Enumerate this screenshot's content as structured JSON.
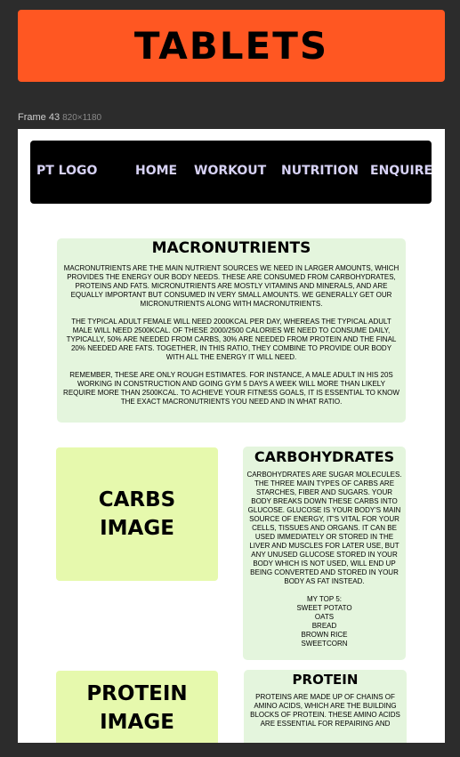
{
  "banner": {
    "title": "TABLETS",
    "color": "#ff5722"
  },
  "frame": {
    "name": "Frame 43",
    "dimensions": "820×1180"
  },
  "nav": {
    "logo": "PT LOGO",
    "items": [
      "HOME",
      "WORKOUT",
      "NUTRITION",
      "ENQUIRE"
    ]
  },
  "macronutrients": {
    "heading": "MACRONUTRIENTS",
    "paragraphs": [
      "Macronutrients are the main nutrient sources we need in larger amounts, which provides the energy our body needs. These are consumed from carbohydrates, proteins and fats. Micronutrients are mostly vitamins and minerals, and are equally important but consumed in very small amounts. We generally get our micronutrients along with macronutrients.",
      "The typical adult female will need 2000kcal per day, whereas the typical adult male will need 2500kcal. Of these 2000/2500 calories we need to consume daily, typically, 50% are needed from carbs, 30% are needed from protein and the final 20% needed are fats. Together, in this ratio, they combine to provide our body with all the energy it will need.",
      "Remember, these are only rough estimates. For instance, a male adult in his 20s working in construction and going gym 5 days a week will more than likely require more than 2500kcal. To achieve your fitness goals, it is essential to know the exact macronutrients you need and in what ratio."
    ]
  },
  "carbs": {
    "image_label": "CARBS IMAGE",
    "heading": "CARBOHYDRATES",
    "text": "Carbohydrates are sugar molecules. The three main types of carbs are starches, fiber and sugars. Your body breaks down these carbs into glucose. Glucose is your body's main source of energy, it's vital for your cells, tissues and organs. It can be used immediately or stored in the liver and muscles for later use, but any unused glucose stored in your body which is not used, will end up being converted and stored in your body as fat instead.",
    "top5_title": "My top 5:",
    "top5": [
      "Sweet Potato",
      "Oats",
      "Bread",
      "Brown Rice",
      "Sweetcorn"
    ]
  },
  "protein": {
    "image_label": "PROTEIN IMAGE",
    "heading": "PROTEIN",
    "text": "Proteins are made up of chains of amino acids, which are the building blocks of protein. These amino acids are essential for repairing and"
  },
  "colors": {
    "background": "#2c2c2c",
    "card_green": "#e4f5dd",
    "image_yellow_green": "#e6f9ad",
    "nav_text": "#d7d2f5"
  }
}
